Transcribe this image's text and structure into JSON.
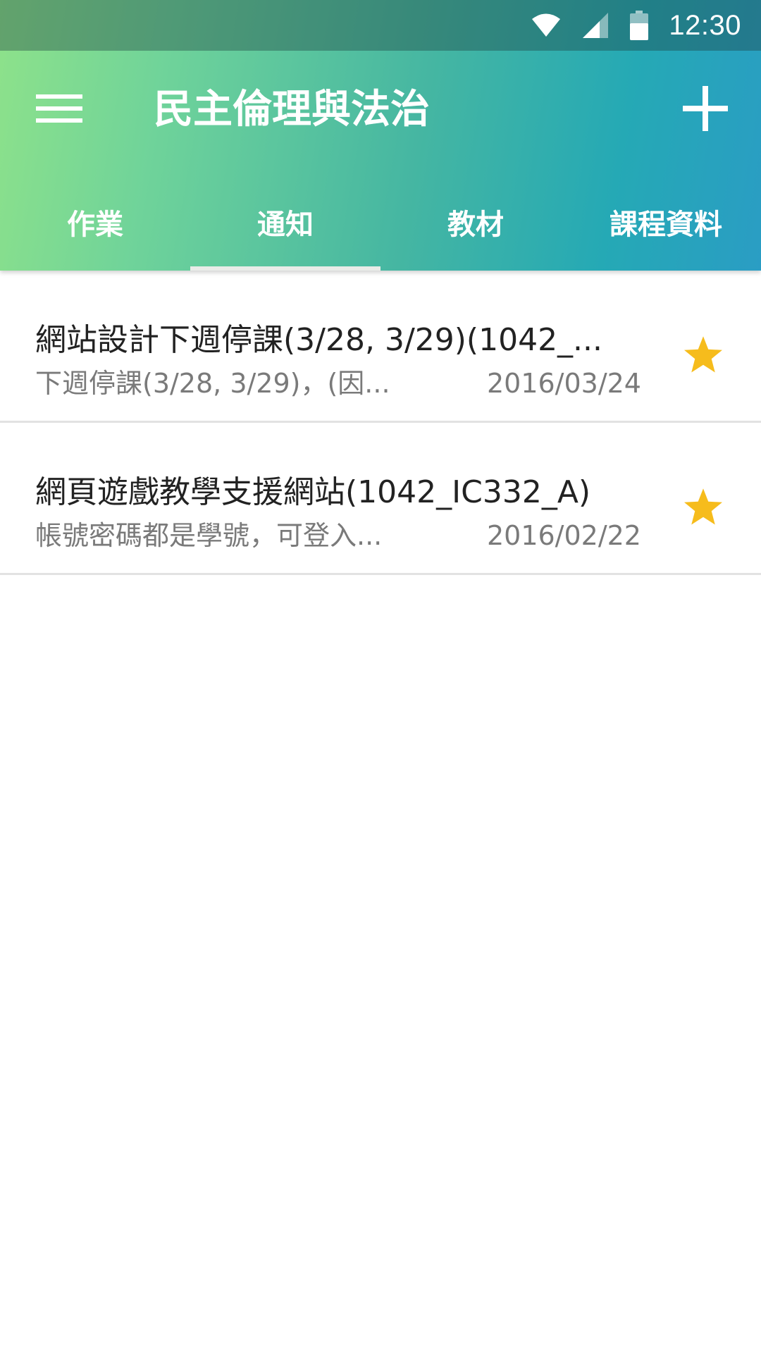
{
  "status_bar": {
    "time": "12:30",
    "icons": [
      "wifi-icon",
      "cell-signal-icon",
      "battery-icon"
    ]
  },
  "toolbar": {
    "menu_icon": "hamburger-menu-icon",
    "title": "民主倫理與法治",
    "add_icon": "plus-icon"
  },
  "tabs": [
    {
      "label": "作業",
      "active": false
    },
    {
      "label": "通知",
      "active": true
    },
    {
      "label": "教材",
      "active": false
    },
    {
      "label": "課程資料",
      "active": false
    }
  ],
  "notifications": [
    {
      "title": "網站設計下週停課(3/28, 3/29)(1042_...",
      "preview": "下週停課(3/28, 3/29)，(因...",
      "date": "2016/03/24",
      "starred": true
    },
    {
      "title": "網頁遊戲教學支援網站(1042_IC332_A)",
      "preview": "帳號密碼都是學號，可登入...",
      "date": "2016/02/22",
      "starred": true
    }
  ],
  "colors": {
    "header_gradient_start": "#8ee28a",
    "header_gradient_end": "#2a9dc4",
    "star": "#f6bc1c",
    "tab_indicator": "#e9ece8",
    "title_text": "#222222",
    "secondary_text": "#7a7a7a",
    "divider": "#e2e2e2"
  }
}
